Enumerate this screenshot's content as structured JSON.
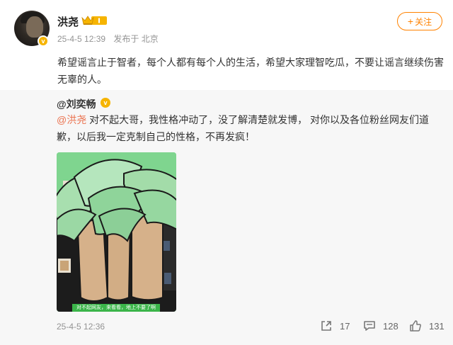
{
  "post": {
    "author": "洪尧",
    "time": "25-4-5 12:39",
    "source": "发布于 北京",
    "follow_label": "关注",
    "text": "希望谣言止于智者，每个人都有每个人的生活，希望大家理智吃瓜，不要让谣言继续伤害无辜的人。"
  },
  "repost": {
    "author": "@刘奕畅",
    "mention": "@洪尧",
    "text": " 对不起大哥，我性格冲动了，没了解清楚就发博，  对你以及各位粉丝网友们道歉，以后我一定克制自己的性格，不再发疯！",
    "image_caption": "对不起网友，来看看，地上不要了啊",
    "time": "25-4-5 12:36",
    "counts": {
      "reposts": "17",
      "comments": "128",
      "likes": "131"
    }
  },
  "icons": {
    "verified": "verified-badge-icon",
    "crown": "vip-crown-icon",
    "repost": "repost-icon",
    "comment": "comment-icon",
    "like": "like-icon"
  },
  "colors": {
    "accent": "#ff8200",
    "mention": "#eb7350",
    "verified": "#f6b400",
    "muted": "#939393"
  }
}
